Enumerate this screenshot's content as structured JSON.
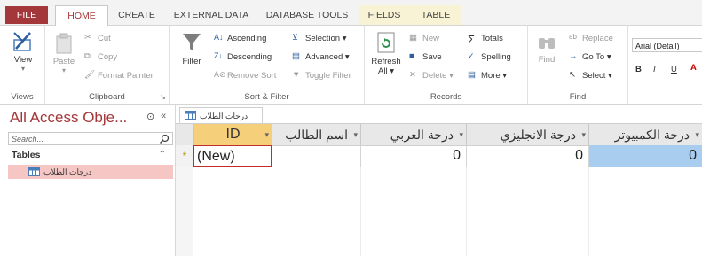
{
  "tabs": [
    "FILE",
    "HOME",
    "CREATE",
    "EXTERNAL DATA",
    "DATABASE TOOLS",
    "FIELDS",
    "TABLE"
  ],
  "groups": {
    "views": {
      "label": "Views",
      "view": "View"
    },
    "clipboard": {
      "label": "Clipboard",
      "paste": "Paste",
      "cut": "Cut",
      "copy": "Copy",
      "format_painter": "Format Painter"
    },
    "sort_filter": {
      "label": "Sort & Filter",
      "filter": "Filter",
      "ascending": "Ascending",
      "descending": "Descending",
      "remove_sort": "Remove Sort",
      "selection": "Selection ▾",
      "advanced": "Advanced ▾",
      "toggle_filter": "Toggle Filter"
    },
    "records": {
      "label": "Records",
      "refresh": "Refresh",
      "refresh_all": "All ▾",
      "new": "New",
      "save": "Save",
      "delete": "Delete",
      "totals": "Totals",
      "spelling": "Spelling",
      "more": "More ▾"
    },
    "find": {
      "label": "Find",
      "find": "Find",
      "replace": "Replace",
      "goto": "Go To ▾",
      "select": "Select ▾"
    },
    "text_formatting": {
      "font": "Arial (Detail)",
      "bold": "B",
      "italic": "I",
      "underline": "U"
    }
  },
  "nav": {
    "title": "All Access Obje...",
    "search_placeholder": "Search...",
    "section": "Tables",
    "items": [
      {
        "label": "درجات الطلاب"
      }
    ]
  },
  "document": {
    "tab_label": "درجات الطلاب",
    "columns": [
      "ID",
      "اسم الطالب",
      "درجة العربي",
      "درجة الانجليزي",
      "درجة الكمبيوتر"
    ],
    "new_row": {
      "id": "(New)",
      "arabic": "0",
      "english": "0",
      "computer": "0",
      "marker": "*"
    }
  },
  "colors": {
    "accent": "#a4373a",
    "id_header": "#f6cf7a",
    "selected_cell": "#a9cdef",
    "nav_selected": "#f6c6c5"
  }
}
